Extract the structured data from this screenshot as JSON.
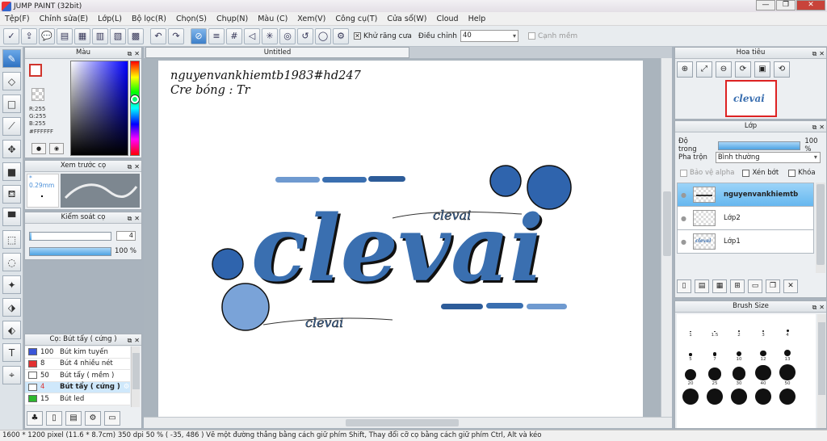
{
  "window": {
    "title": "JUMP PAINT (32bit)",
    "minimize": "—",
    "maximize": "❐",
    "close": "✕"
  },
  "menu": [
    "Tệp(F)",
    "Chỉnh sửa(E)",
    "Lớp(L)",
    "Bộ lọc(R)",
    "Chọn(S)",
    "Chụp(N)",
    "Màu (C)",
    "Xem(V)",
    "Công cụ(T)",
    "Cửa sổ(W)",
    "Cloud",
    "Help"
  ],
  "toolbar": {
    "antialias_label": "Khử răng cưa",
    "adjust_label": "Điều chỉnh",
    "adjust_value": "40",
    "edge_label": "Cạnh mềm"
  },
  "color_panel": {
    "title": "Màu",
    "r": "R:255",
    "g": "G:255",
    "b": "B:255",
    "hex": "#FFFFFF",
    "fg_color": "#d0342c"
  },
  "preview_panel": {
    "title": "Xem trước cọ",
    "size": "* 0.29mm"
  },
  "control_panel": {
    "title": "Kiểm soát cọ",
    "size_value": "4",
    "size_fraction": 0.02,
    "opacity_value": "100 %",
    "opacity_fraction": 1.0
  },
  "brush_list": {
    "title": "Cọ: Bút tẩy ( cứng )",
    "items": [
      {
        "size": "100",
        "name": "Bút kim tuyến",
        "color": "#3a55d8"
      },
      {
        "size": "8",
        "name": "Bút 4 nhiều nét",
        "color": "#e33030"
      },
      {
        "size": "50",
        "name": "Bút tẩy ( mềm )",
        "color": "#ffffff"
      },
      {
        "size": "4",
        "name": "Bút tẩy ( cứng )",
        "color": "#ffffff"
      },
      {
        "size": "15",
        "name": "Bút led",
        "color": "#2db82d"
      }
    ]
  },
  "canvas": {
    "tab_title": "Untitled",
    "watermark_line1": "nguyenvankhiemtb1983#hd247",
    "watermark_line2": "Cre bóng : Tr",
    "logo_text": "clevai",
    "logo_small_text": "clevai",
    "logo_color": "#3a6fb0"
  },
  "navigator": {
    "title": "Hoa tiêu",
    "thumb_text": "clevai"
  },
  "layers": {
    "title": "Lớp",
    "opacity_label": "Độ trong",
    "opacity_value": "100 %",
    "blend_label": "Pha trộn",
    "blend_value": "Bình thường",
    "protect_alpha": "Bảo vệ alpha",
    "clip_label": "Xén bớt",
    "lock_label": "Khóa",
    "items": [
      {
        "name": "nguyenvankhiemtb"
      },
      {
        "name": "Lớp2"
      },
      {
        "name": "Lớp1"
      }
    ]
  },
  "brush_size": {
    "title": "Brush Size",
    "labels": [
      "1",
      "1.5",
      "2",
      "3",
      "4",
      "5",
      "7",
      "10",
      "12",
      "13",
      "20",
      "25",
      "30",
      "40",
      "50",
      "",
      "",
      "",
      "",
      ""
    ]
  },
  "status": "1600 * 1200 pixel  (11.6 * 8.7cm)  350 dpi  50 %  ( -35, 486 )  Vẽ một đường thẳng bằng cách giữ phím Shift, Thay đổi cỡ cọ bằng cách giữ phím Ctrl, Alt và kéo"
}
